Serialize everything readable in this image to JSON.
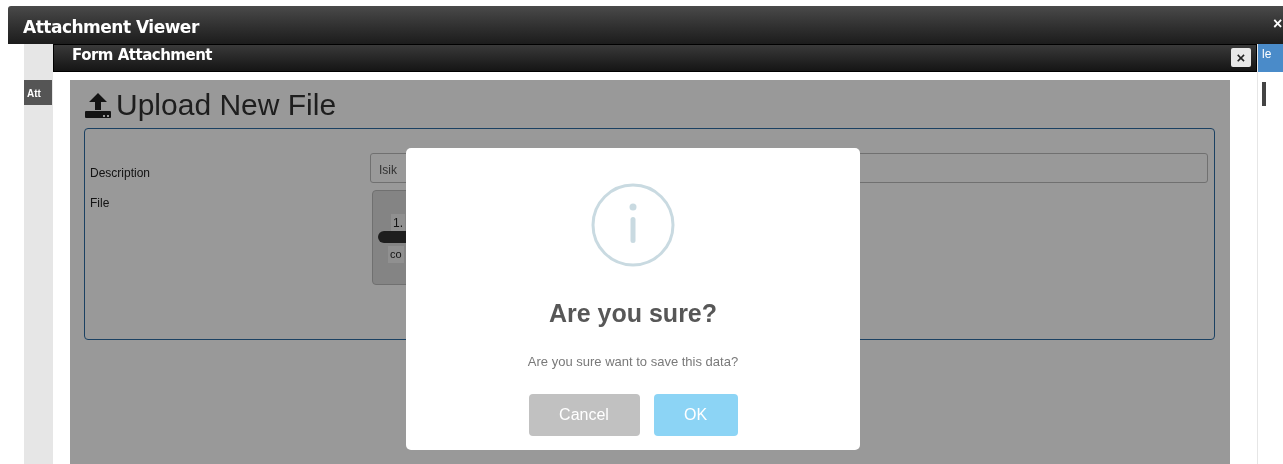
{
  "outer_window": {
    "title": "Attachment Viewer",
    "close": "×",
    "side_tab": "Att",
    "right_tab": "le"
  },
  "inner_window": {
    "title": "Form Attachment",
    "close": "×"
  },
  "form": {
    "heading": "Upload New File",
    "fields": [
      {
        "label": "Description",
        "kind": "text",
        "value": "Isik"
      },
      {
        "label": "File",
        "kind": "file",
        "size": "1.",
        "status": "co"
      }
    ]
  },
  "alert": {
    "title": "Are you sure?",
    "message": "Are you sure want to save this data?",
    "buttons": [
      {
        "label": "Cancel",
        "kind": "cancel"
      },
      {
        "label": "OK",
        "kind": "confirm"
      }
    ]
  }
}
